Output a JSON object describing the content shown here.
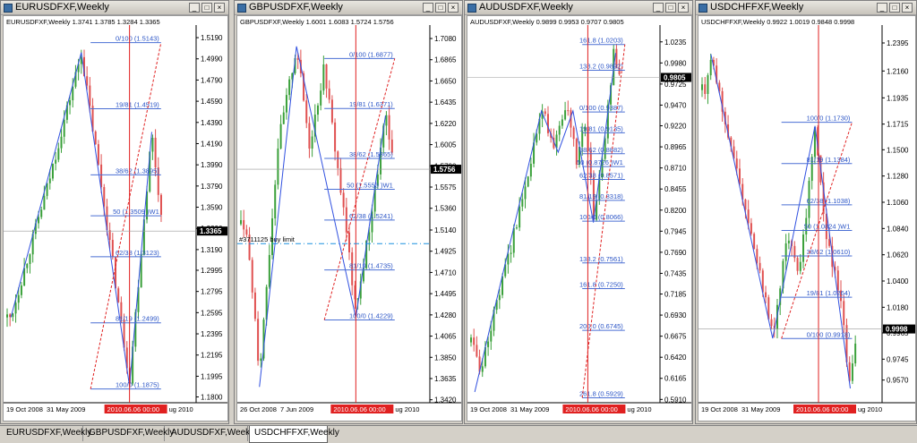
{
  "tabs": [
    {
      "label": "EURUSDFXF,Weekly",
      "active": false
    },
    {
      "label": "GBPUSDFXF,Weekly",
      "active": false
    },
    {
      "label": "AUDUSDFXF,Weekly",
      "active": false
    },
    {
      "label": "USDCHFFXF,Weekly",
      "active": true
    }
  ],
  "colors": {
    "fib": "#4a6fd4",
    "fib_text": "#2b55c6",
    "vline": "#e02020",
    "bull": "#3aa03a",
    "bear": "#e05050",
    "zigzag": "#3050e0",
    "cursor_bg": "#e02020",
    "price_bg": "#000000"
  },
  "charts": [
    {
      "title": "EURUSDFXF,Weekly",
      "header": "EURUSDFXF,Weekly  1.3741 1.3785 1.3284 1.3365",
      "ylim": [
        1.1745,
        1.5275
      ],
      "yticks": [
        "1.5190",
        "1.4990",
        "1.4790",
        "1.4590",
        "1.4390",
        "1.4190",
        "1.3990",
        "1.3790",
        "1.3590",
        "1.3390",
        "1.3190",
        "1.2995",
        "1.2795",
        "1.2595",
        "1.2395",
        "1.2195",
        "1.1995",
        "1.1800"
      ],
      "current_price": {
        "value": 1.3365,
        "label": "1.3365"
      },
      "xlabels": [
        "19 Oct 2008",
        "31 May 2009",
        "ug 2010"
      ],
      "cursor_label": "2010.06.06 00:00",
      "fib_levels": [
        {
          "label": "0/100 (1.5143)",
          "price": 1.5143
        },
        {
          "label": "19/81 (1.4519)",
          "price": 1.4519
        },
        {
          "label": "38/62 (1.3895)",
          "price": 1.3895
        },
        {
          "label": "50 (1.3509 )W1",
          "price": 1.3509
        },
        {
          "label": "62/38 (1.3123)",
          "price": 1.3123
        },
        {
          "label": "81/19 (1.2499)",
          "price": 1.2499
        },
        {
          "label": "100/0 (1.1875)",
          "price": 1.1875
        }
      ],
      "swings": [
        [
          0.02,
          1.255
        ],
        [
          0.22,
          1.38
        ],
        [
          0.4,
          1.505
        ],
        [
          0.55,
          1.33
        ],
        [
          0.66,
          1.195
        ],
        [
          0.78,
          1.43
        ],
        [
          0.84,
          1.336
        ]
      ],
      "zigzag": [
        [
          0.02,
          1.255
        ],
        [
          0.4,
          1.505
        ],
        [
          0.66,
          1.19
        ],
        [
          0.78,
          1.43
        ]
      ]
    },
    {
      "title": "GBPUSDFXF,Weekly",
      "header": "GBPUSDFXF,Weekly  1.6001 1.6083 1.5724 1.5756",
      "ylim": [
        1.339,
        1.718
      ],
      "yticks": [
        "1.7080",
        "1.6865",
        "1.6650",
        "1.6435",
        "1.6220",
        "1.6005",
        "1.5790",
        "1.5575",
        "1.5360",
        "1.5140",
        "1.4925",
        "1.4710",
        "1.4495",
        "1.4280",
        "1.4065",
        "1.3850",
        "1.3635",
        "1.3420"
      ],
      "current_price": {
        "value": 1.5756,
        "label": "1.5756"
      },
      "buy_limit": {
        "value": 1.5002,
        "label": "#3711125 buy limit"
      },
      "xlabels": [
        "26 Oct 2008",
        "7 Jun 2009",
        "ug 2010"
      ],
      "cursor_label": "2010.06.06 00:00",
      "fib_levels": [
        {
          "label": "0/100 (1.6877)",
          "price": 1.6877
        },
        {
          "label": "19/81 (1.6371)",
          "price": 1.6371
        },
        {
          "label": "38/62 (1.5865)",
          "price": 1.5865
        },
        {
          "label": "50 (1.5553 )W1",
          "price": 1.5553
        },
        {
          "label": "62/38 (1.5241)",
          "price": 1.5241
        },
        {
          "label": "81/19 (1.4735)",
          "price": 1.4735
        },
        {
          "label": "100/0 (1.4229)",
          "price": 1.4229
        }
      ],
      "swings": [
        [
          0.02,
          1.52
        ],
        [
          0.07,
          1.44
        ],
        [
          0.1,
          1.37
        ],
        [
          0.2,
          1.6
        ],
        [
          0.3,
          1.7
        ],
        [
          0.37,
          1.6
        ],
        [
          0.45,
          1.68
        ],
        [
          0.52,
          1.58
        ],
        [
          0.57,
          1.51
        ],
        [
          0.62,
          1.43
        ],
        [
          0.72,
          1.55
        ],
        [
          0.78,
          1.63
        ],
        [
          0.82,
          1.58
        ]
      ],
      "zigzag": [
        [
          0.1,
          1.355
        ],
        [
          0.3,
          1.7
        ],
        [
          0.62,
          1.425
        ],
        [
          0.78,
          1.63
        ]
      ]
    },
    {
      "title": "AUDUSDFXF,Weekly",
      "header": "AUDUSDFXF,Weekly  0.9899 0.9953 0.9707 0.9805",
      "ylim": [
        0.587,
        1.0395
      ],
      "yticks": [
        "1.0235",
        "0.9980",
        "0.9725",
        "0.9470",
        "0.9220",
        "0.8965",
        "0.8710",
        "0.8455",
        "0.8200",
        "0.7945",
        "0.7690",
        "0.7435",
        "0.7185",
        "0.6930",
        "0.6675",
        "0.6420",
        "0.6165",
        "0.5910"
      ],
      "current_price": {
        "value": 0.9805,
        "label": "0.9805"
      },
      "xlabels": [
        "19 Oct 2008",
        "31 May 2009",
        "ug 2010"
      ],
      "cursor_label": "2010.06.06 00:00",
      "fib_levels": [
        {
          "label": "161.8 (1.0203)",
          "price": 1.0203
        },
        {
          "label": "138.2 (0.9892)",
          "price": 0.9892
        },
        {
          "label": "0/100 (0.9387)",
          "price": 0.9387
        },
        {
          "label": "19/81 (0.9135)",
          "price": 0.9135
        },
        {
          "label": "38/62 (0.8882)",
          "price": 0.8882
        },
        {
          "label": "50 (0.8726 )W1",
          "price": 0.8726
        },
        {
          "label": "62/38 (0.8571)",
          "price": 0.8571
        },
        {
          "label": "81/19 (0.8318)",
          "price": 0.8318
        },
        {
          "label": "100/0 (0.8066)",
          "price": 0.8066
        },
        {
          "label": "138.2 (0.7561)",
          "price": 0.7561
        },
        {
          "label": "161.8 (0.7250)",
          "price": 0.725
        },
        {
          "label": "200.0 (0.6745)",
          "price": 0.6745
        },
        {
          "label": "261.8 (0.5929)",
          "price": 0.5929
        }
      ],
      "swings": [
        [
          0.01,
          0.66
        ],
        [
          0.05,
          0.62
        ],
        [
          0.12,
          0.69
        ],
        [
          0.22,
          0.78
        ],
        [
          0.3,
          0.86
        ],
        [
          0.38,
          0.94
        ],
        [
          0.45,
          0.9
        ],
        [
          0.52,
          0.94
        ],
        [
          0.57,
          0.88
        ],
        [
          0.62,
          0.93
        ],
        [
          0.66,
          0.81
        ],
        [
          0.72,
          0.9
        ],
        [
          0.77,
          1.01
        ],
        [
          0.8,
          0.98
        ]
      ],
      "zigzag": [
        [
          0.02,
          0.6
        ],
        [
          0.38,
          0.94
        ],
        [
          0.47,
          0.89
        ],
        [
          0.55,
          0.94
        ],
        [
          0.66,
          0.805
        ],
        [
          0.78,
          1.01
        ]
      ]
    },
    {
      "title": "USDCHFFXF,Weekly",
      "header": "USDCHFFXF,Weekly  0.9922 1.0019 0.9848 0.9998",
      "ylim": [
        0.938,
        1.2515
      ],
      "yticks": [
        "1.2395",
        "1.2160",
        "1.1935",
        "1.1715",
        "1.1500",
        "1.1280",
        "1.1060",
        "1.0840",
        "1.0620",
        "1.0400",
        "1.0180",
        "0.9965",
        "0.9745",
        "0.9570"
      ],
      "current_price": {
        "value": 0.9998,
        "label": "0.9998"
      },
      "xlabels": [
        "19 Oct 2008",
        "31 May 2009",
        "ug 2010"
      ],
      "cursor_label": "2010.06.06 00:00",
      "fib_levels": [
        {
          "label": "100/0 (1.1730)",
          "price": 1.173
        },
        {
          "label": "81/19 (1.1384)",
          "price": 1.1384
        },
        {
          "label": "62/38 (1.1038)",
          "price": 1.1038
        },
        {
          "label": "50 (1.0824 )W1",
          "price": 1.0824
        },
        {
          "label": "38/62 (1.0610)",
          "price": 1.061
        },
        {
          "label": "19/81 (1.0264)",
          "price": 1.0264
        },
        {
          "label": "0/100 (0.9918)",
          "price": 0.9918
        }
      ],
      "swings": [
        [
          0.02,
          1.2
        ],
        [
          0.05,
          1.23
        ],
        [
          0.12,
          1.18
        ],
        [
          0.25,
          1.1
        ],
        [
          0.35,
          1.03
        ],
        [
          0.4,
          0.992
        ],
        [
          0.48,
          1.08
        ],
        [
          0.55,
          1.04
        ],
        [
          0.64,
          1.17
        ],
        [
          0.7,
          1.08
        ],
        [
          0.78,
          1.03
        ],
        [
          0.84,
          0.95
        ],
        [
          0.88,
          1.0
        ]
      ],
      "zigzag": [
        [
          0.05,
          1.23
        ],
        [
          0.4,
          0.992
        ],
        [
          0.64,
          1.17
        ],
        [
          0.84,
          0.95
        ]
      ]
    }
  ]
}
